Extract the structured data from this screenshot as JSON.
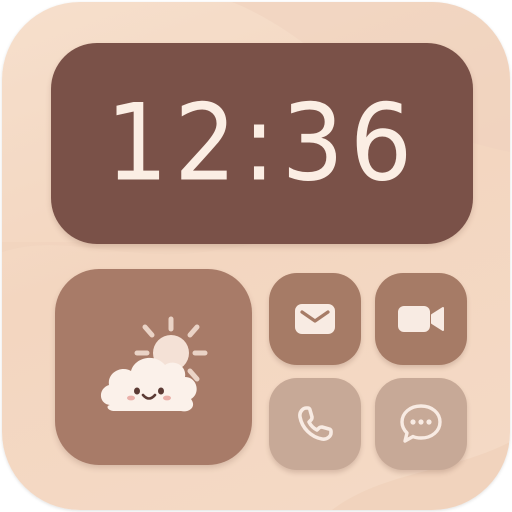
{
  "clock": {
    "time": "12:36"
  },
  "icons": {
    "weather": "sun-cloud-icon",
    "mail": "envelope-icon",
    "video": "video-camera-icon",
    "phone": "phone-icon",
    "message": "chat-bubble-icon"
  },
  "colors": {
    "background": "#f4dac6",
    "clock_widget": "#7a5148",
    "clock_text": "#fbeee4",
    "weather_widget": "#a87b68",
    "dark_buttons": "#a67b66",
    "light_buttons": "#c7a997",
    "icon_fill": "#f8ebe3"
  }
}
